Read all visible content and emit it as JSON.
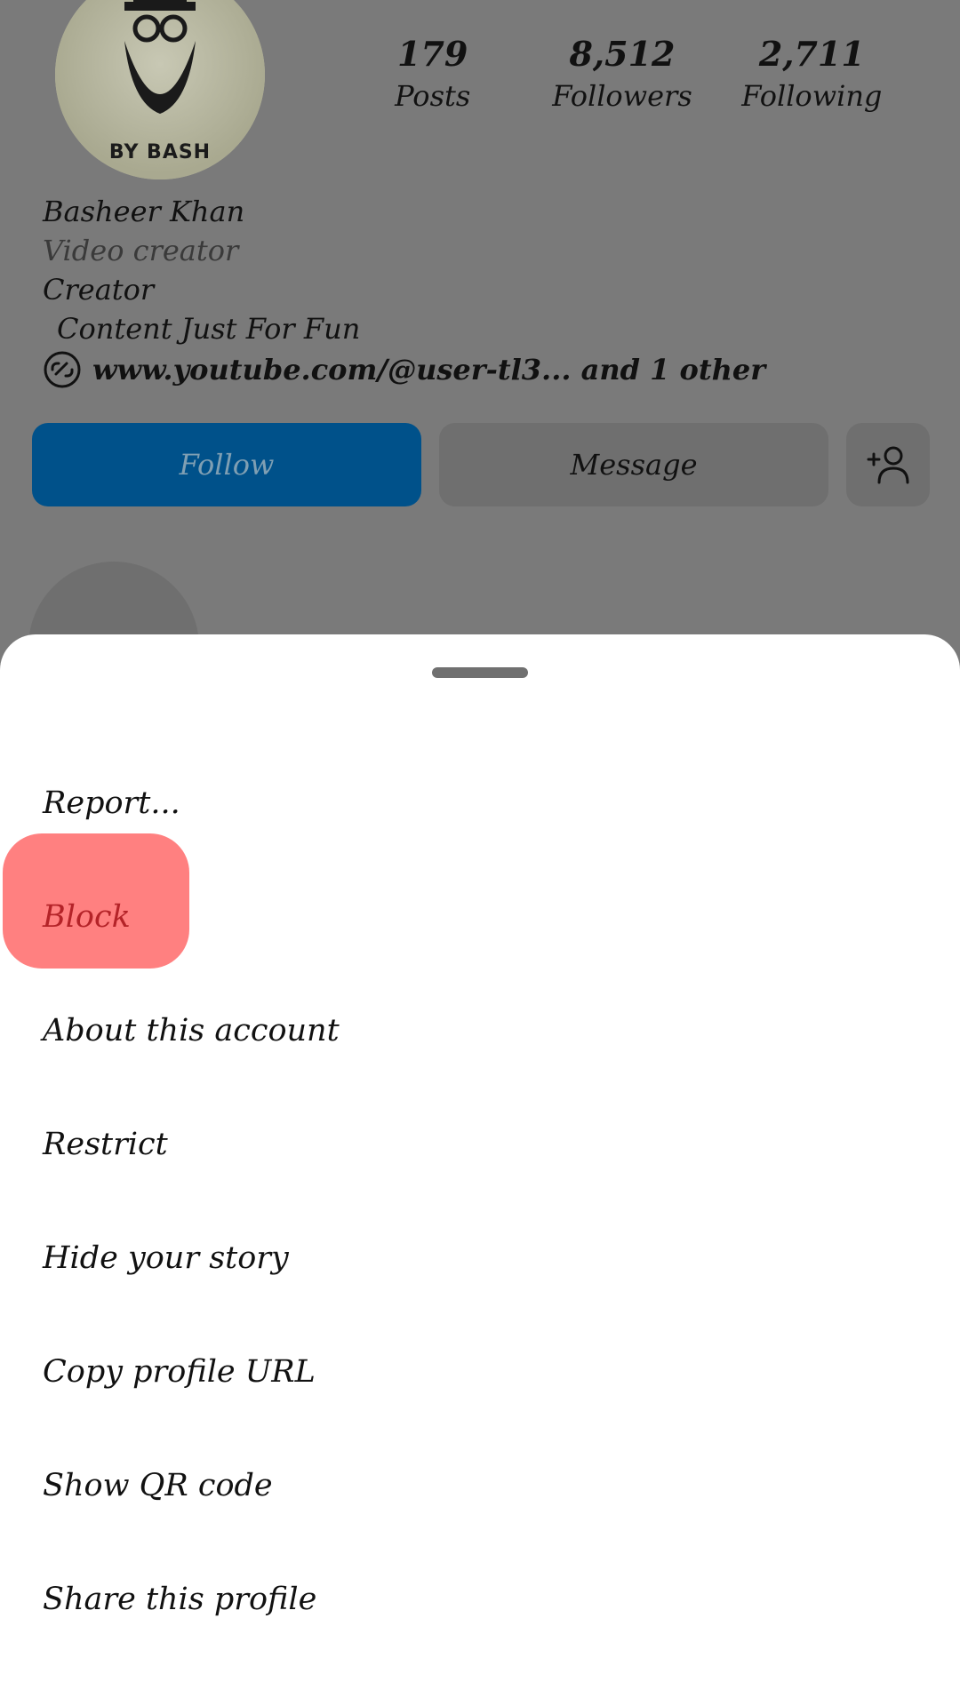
{
  "profile": {
    "avatar_badge": "BY BASH",
    "stats": [
      {
        "value": "179",
        "label": "Posts"
      },
      {
        "value": "8,512",
        "label": "Followers"
      },
      {
        "value": "2,711",
        "label": "Following"
      }
    ],
    "name": "Basheer Khan",
    "category": "Video creator",
    "bio_line1": "Creator",
    "bio_line2": "Content Just For Fun",
    "link_text": "www.youtube.com/@user-tl3... and 1 other",
    "follow_label": "Follow",
    "message_label": "Message",
    "add_user_icon": "add-person-icon"
  },
  "sheet": {
    "items": [
      {
        "label": "Report..."
      },
      {
        "label": "Block"
      },
      {
        "label": "About this account"
      },
      {
        "label": "Restrict"
      },
      {
        "label": "Hide your story"
      },
      {
        "label": "Copy profile URL"
      },
      {
        "label": "Show QR code"
      },
      {
        "label": "Share this profile"
      }
    ]
  },
  "colors": {
    "follow_blue": "#00518a",
    "block_red": "#b42328",
    "highlight": "#ff8080",
    "overlay_dim": "#7a7a7a"
  }
}
